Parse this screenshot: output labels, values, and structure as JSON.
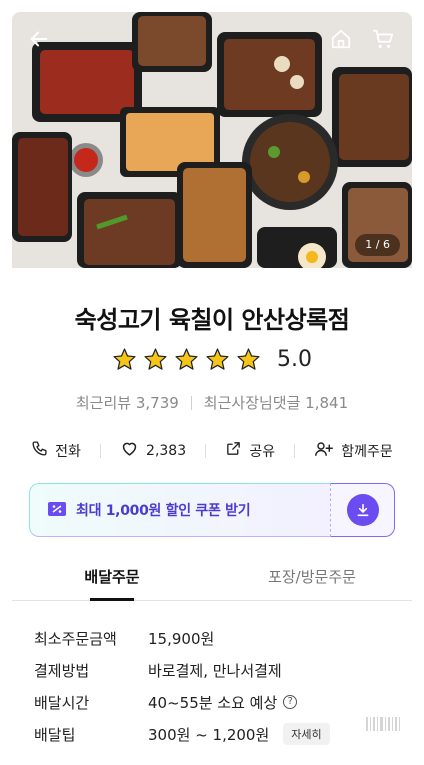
{
  "hero": {
    "page_counter": "1 / 6",
    "icons": {
      "back": "arrow-left-icon",
      "home": "home-icon",
      "cart": "cart-icon"
    }
  },
  "store": {
    "name": "숙성고기 육칠이 안산상록점",
    "rating": {
      "value": "5.0",
      "stars": 5,
      "max_stars": 5,
      "star_color": "#f5c518"
    },
    "recent_reviews": "최근리뷰 3,739",
    "owner_replies": "최근사장님댓글 1,841"
  },
  "actions": [
    {
      "label": "전화",
      "icon": "phone-icon"
    },
    {
      "label": "2,383",
      "icon": "heart-icon"
    },
    {
      "label": "공유",
      "icon": "share-icon"
    },
    {
      "label": "함께주문",
      "icon": "group-order-icon"
    }
  ],
  "coupon": {
    "text": "최대 1,000원 할인 쿠폰 받기",
    "accent": "#6a4cf0",
    "icon": "coupon-icon",
    "download_icon": "download-icon"
  },
  "tabs": [
    {
      "label": "배달주문",
      "active": true
    },
    {
      "label": "포장/방문주문",
      "active": false
    }
  ],
  "details": {
    "min_order": {
      "label": "최소주문금액",
      "value": "15,900원"
    },
    "payment": {
      "label": "결제방법",
      "value": "바로결제, 만나서결제"
    },
    "delivery_time": {
      "label": "배달시간",
      "value": "40~55분 소요 예상",
      "help": "?"
    },
    "delivery_tip": {
      "label": "배달팁",
      "value": "300원 ~ 1,200원",
      "button": "자세히"
    }
  }
}
